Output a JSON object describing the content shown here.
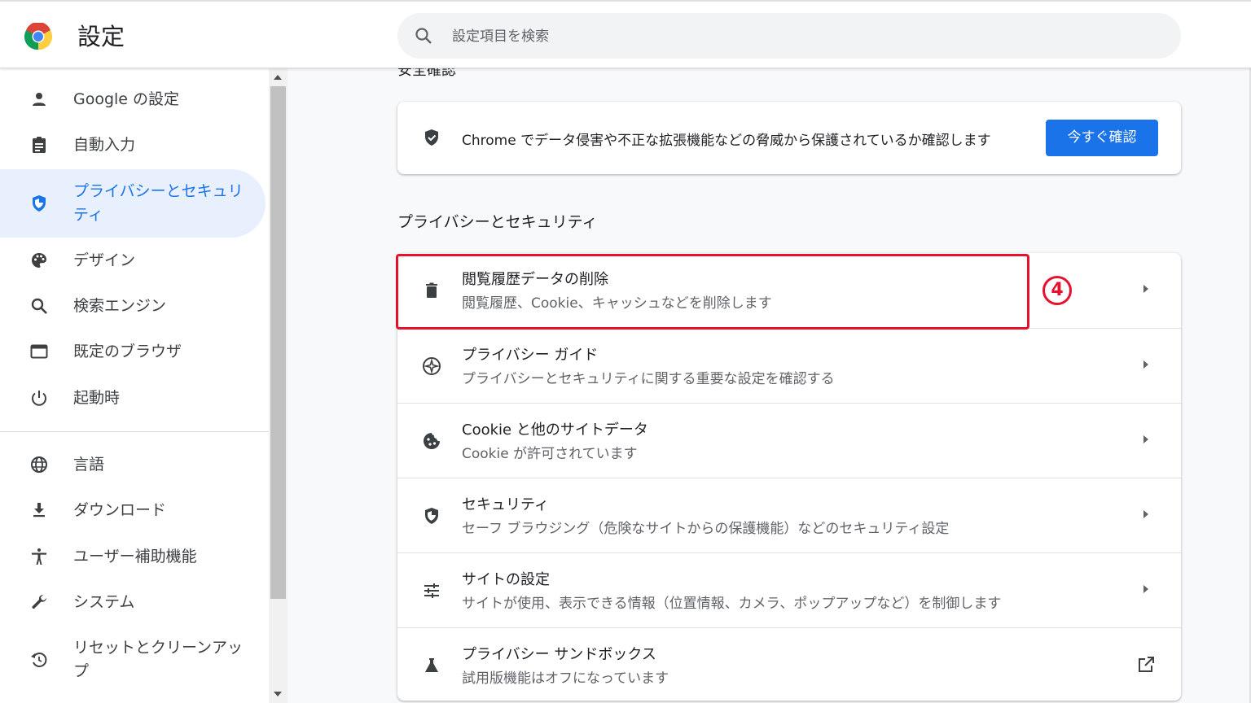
{
  "header": {
    "title": "設定",
    "search_placeholder": "設定項目を検索"
  },
  "sidebar": {
    "items": [
      {
        "label": "Google の設定",
        "icon": "person-icon"
      },
      {
        "label": "自動入力",
        "icon": "clipboard-icon"
      },
      {
        "label": "プライバシーとセキュリティ",
        "icon": "shield-icon",
        "active": true
      },
      {
        "label": "デザイン",
        "icon": "palette-icon"
      },
      {
        "label": "検索エンジン",
        "icon": "search-icon"
      },
      {
        "label": "既定のブラウザ",
        "icon": "browser-icon"
      },
      {
        "label": "起動時",
        "icon": "power-icon"
      },
      {
        "label": "言語",
        "icon": "globe-icon"
      },
      {
        "label": "ダウンロード",
        "icon": "download-icon"
      },
      {
        "label": "ユーザー補助機能",
        "icon": "accessibility-icon"
      },
      {
        "label": "システム",
        "icon": "wrench-icon"
      },
      {
        "label": "リセットとクリーンアップ",
        "icon": "restore-icon"
      }
    ]
  },
  "main": {
    "cut_section_title": "安全確認",
    "safety_check": {
      "text": "Chrome でデータ侵害や不正な拡張機能などの脅威から保護されているか確認します",
      "button": "今すぐ確認"
    },
    "section_title": "プライバシーとセキュリティ",
    "rows": [
      {
        "title": "閲覧履歴データの削除",
        "subtitle": "閲覧履歴、Cookie、キャッシュなどを削除します",
        "icon": "trash-icon"
      },
      {
        "title": "プライバシー ガイド",
        "subtitle": "プライバシーとセキュリティに関する重要な設定を確認する",
        "icon": "compass-icon"
      },
      {
        "title": "Cookie と他のサイトデータ",
        "subtitle": "Cookie が許可されています",
        "icon": "cookie-icon"
      },
      {
        "title": "セキュリティ",
        "subtitle": "セーフ ブラウジング（危険なサイトからの保護機能）などのセキュリティ設定",
        "icon": "security-shield-icon"
      },
      {
        "title": "サイトの設定",
        "subtitle": "サイトが使用、表示できる情報（位置情報、カメラ、ポップアップなど）を制御します",
        "icon": "tune-icon"
      },
      {
        "title": "プライバシー サンドボックス",
        "subtitle": "試用版機能はオフになっています",
        "icon": "flask-icon"
      }
    ]
  },
  "annotation": {
    "step_number": "4",
    "color": "#e8112d"
  },
  "colors": {
    "accent": "#1a73e8",
    "active_bg": "#e8f0fe"
  }
}
